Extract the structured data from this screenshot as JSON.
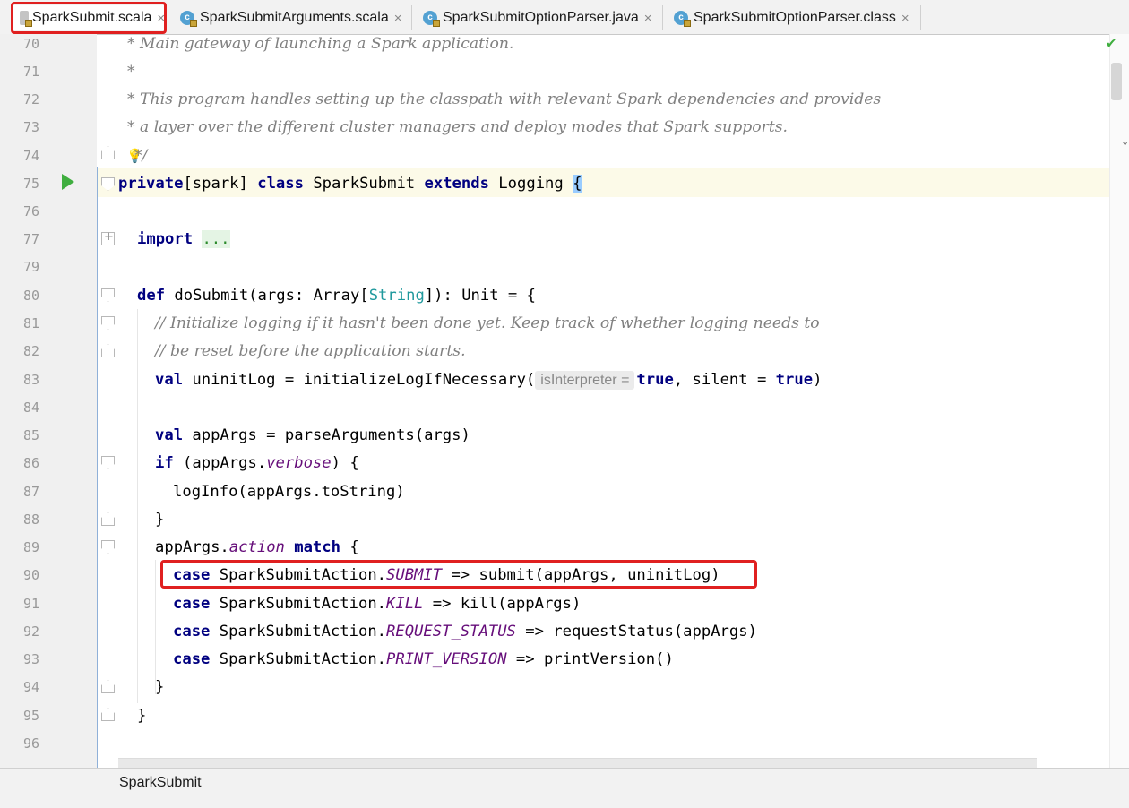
{
  "tabs": [
    {
      "label": "SparkSubmit.scala",
      "icon": "scala-file-icon",
      "active": true
    },
    {
      "label": "SparkSubmitArguments.scala",
      "icon": "class-icon",
      "active": false
    },
    {
      "label": "SparkSubmitOptionParser.java",
      "icon": "class-icon",
      "active": false
    },
    {
      "label": "SparkSubmitOptionParser.class",
      "icon": "class-icon",
      "active": false
    }
  ],
  "tab_close_glyph": "×",
  "line_numbers": [
    "70",
    "71",
    "72",
    "73",
    "74",
    "75",
    "76",
    "77",
    "79",
    "80",
    "81",
    "82",
    "83",
    "84",
    "85",
    "86",
    "87",
    "88",
    "89",
    "90",
    "91",
    "92",
    "93",
    "94",
    "95",
    "96"
  ],
  "code": {
    "l70": "* Main gateway of launching a Spark application.",
    "l71": "*",
    "l72": "* This program handles setting up the classpath with relevant Spark dependencies and provides",
    "l73": "* a layer over the different cluster managers and deploy modes that Spark supports.",
    "l74": "*/",
    "l75_kw1": "private",
    "l75_a": "[spark] ",
    "l75_kw2": "class",
    "l75_b": " SparkSubmit ",
    "l75_kw3": "extends",
    "l75_c": " Logging ",
    "l75_brace": "{",
    "l77_kw": "import",
    "l77_dots": "...",
    "l80_kw": "def",
    "l80_a": " doSubmit(args: Array[",
    "l80_type": "String",
    "l80_b": "]): Unit = {",
    "l81": "// Initialize logging if it hasn't been done yet. Keep track of whether logging needs to",
    "l82": "// be reset before the application starts.",
    "l83_kw": "val",
    "l83_a": " uninitLog = initializeLogIfNecessary(",
    "l83_hint": "isInterpreter =",
    "l83_true1": "true",
    "l83_b": ", silent = ",
    "l83_true2": "true",
    "l83_c": ")",
    "l85_kw": "val",
    "l85_a": " appArgs = parseArguments(args)",
    "l86_kw": "if",
    "l86_a": " (appArgs.",
    "l86_field": "verbose",
    "l86_b": ") {",
    "l87": "logInfo(appArgs.toString)",
    "l88": "}",
    "l89_a": "appArgs.",
    "l89_field": "action",
    "l89_kw": " match",
    "l89_b": " {",
    "l90_kw": "case",
    "l90_a": " SparkSubmitAction.",
    "l90_const": "SUBMIT",
    "l90_b": " => submit(appArgs, uninitLog)",
    "l91_kw": "case",
    "l91_a": " SparkSubmitAction.",
    "l91_const": "KILL",
    "l91_b": " => kill(appArgs)",
    "l92_kw": "case",
    "l92_a": " SparkSubmitAction.",
    "l92_const": "REQUEST_STATUS",
    "l92_b": " => requestStatus(appArgs)",
    "l93_kw": "case",
    "l93_a": " SparkSubmitAction.",
    "l93_const": "PRINT_VERSION",
    "l93_b": " => printVersion()",
    "l94": "}",
    "l95": "}"
  },
  "breadcrumb": "SparkSubmit",
  "colors": {
    "keyword": "#000080",
    "comment": "#808080",
    "type": "#20999d",
    "field_italic": "#660e7a",
    "highlight_box": "#e02020",
    "run_icon": "#3fae3f"
  }
}
